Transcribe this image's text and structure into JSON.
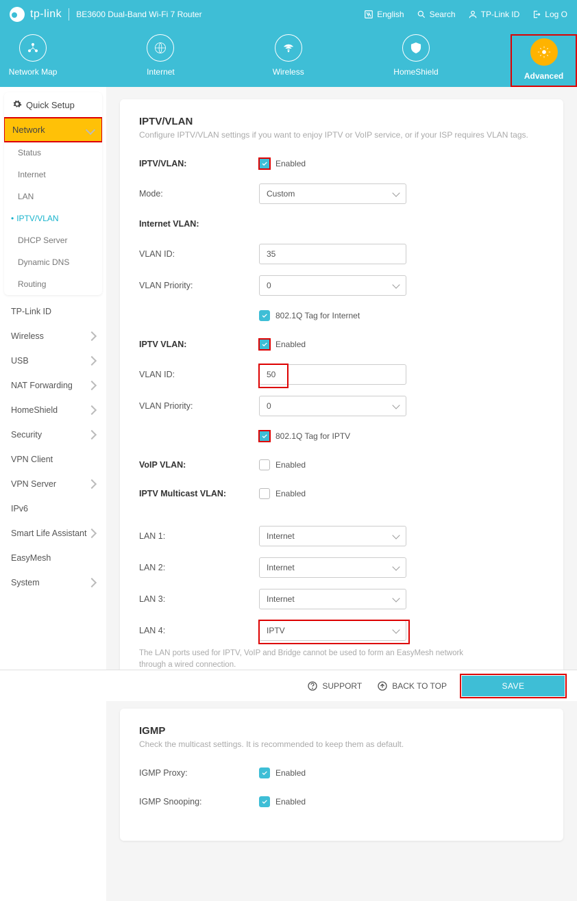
{
  "header": {
    "brand": "tp-link",
    "model": "BE3600 Dual-Band Wi-Fi 7 Router",
    "right": {
      "language": "English",
      "search": "Search",
      "tp_id": "TP-Link ID",
      "logout": "Log O"
    }
  },
  "nav": {
    "tabs": [
      {
        "label": "Network Map"
      },
      {
        "label": "Internet"
      },
      {
        "label": "Wireless"
      },
      {
        "label": "HomeShield"
      },
      {
        "label": "Advanced",
        "active": true
      }
    ]
  },
  "sidebar": {
    "quick_setup": "Quick Setup",
    "network": "Network",
    "network_sub": [
      {
        "label": "Status"
      },
      {
        "label": "Internet"
      },
      {
        "label": "LAN"
      },
      {
        "label": "IPTV/VLAN",
        "active": true
      },
      {
        "label": "DHCP Server"
      },
      {
        "label": "Dynamic DNS"
      },
      {
        "label": "Routing"
      }
    ],
    "items": [
      {
        "label": "TP-Link ID"
      },
      {
        "label": "Wireless",
        "chev": true
      },
      {
        "label": "USB",
        "chev": true
      },
      {
        "label": "NAT Forwarding",
        "chev": true
      },
      {
        "label": "HomeShield",
        "chev": true
      },
      {
        "label": "Security",
        "chev": true
      },
      {
        "label": "VPN Client"
      },
      {
        "label": "VPN Server",
        "chev": true
      },
      {
        "label": "IPv6"
      },
      {
        "label": "Smart Life Assistant",
        "chev": true
      },
      {
        "label": "EasyMesh"
      },
      {
        "label": "System",
        "chev": true
      }
    ]
  },
  "iptv": {
    "title": "IPTV/VLAN",
    "desc": "Configure IPTV/VLAN settings if you want to enjoy IPTV or VoIP service, or if your ISP requires VLAN tags.",
    "label_iptvvlan": "IPTV/VLAN:",
    "enabled": "Enabled",
    "label_mode": "Mode:",
    "mode_value": "Custom",
    "internet_vlan_title": "Internet VLAN:",
    "label_vlan_id": "VLAN ID:",
    "internet_vlan_id": "35",
    "label_vlan_priority": "VLAN Priority:",
    "internet_vlan_priority": "0",
    "tag_internet": "802.1Q Tag for Internet",
    "iptv_vlan_title": "IPTV VLAN:",
    "iptv_vlan_id": "50",
    "iptv_vlan_priority": "0",
    "tag_iptv": "802.1Q Tag for IPTV",
    "voip_vlan_title": "VoIP VLAN:",
    "multicast_vlan_title": "IPTV Multicast VLAN:",
    "lan1_label": "LAN 1:",
    "lan2_label": "LAN 2:",
    "lan3_label": "LAN 3:",
    "lan4_label": "LAN 4:",
    "lan_internet": "Internet",
    "lan_iptv": "IPTV",
    "lan_note": "The LAN ports used for IPTV, VoIP and Bridge cannot be used to form an EasyMesh network through a wired connection."
  },
  "igmp": {
    "title": "IGMP",
    "desc": "Check the multicast settings. It is recommended to keep them as default.",
    "proxy_label": "IGMP Proxy:",
    "snooping_label": "IGMP Snooping:",
    "enabled": "Enabled"
  },
  "footer": {
    "support": "SUPPORT",
    "back_to_top": "BACK TO TOP",
    "save": "SAVE"
  }
}
